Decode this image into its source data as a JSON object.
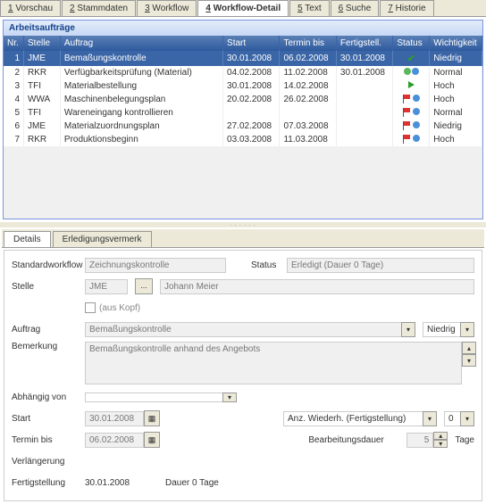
{
  "mainTabs": [
    "1 Vorschau",
    "2 Stammdaten",
    "3 Workflow",
    "4 Workflow-Detail",
    "5 Text",
    "6 Suche",
    "7 Historie"
  ],
  "mainTabActive": 3,
  "sectionTitle": "Arbeitsaufträge",
  "columns": {
    "nr": "Nr.",
    "stelle": "Stelle",
    "auftrag": "Auftrag",
    "start": "Start",
    "termin": "Termin bis",
    "fertig": "Fertigstell.",
    "status": "Status",
    "wicht": "Wichtigkeit"
  },
  "rows": [
    {
      "nr": "1",
      "stelle": "JME",
      "auftrag": "Bemaßungskontrolle",
      "start": "30.01.2008",
      "termin": "06.02.2008",
      "fertig": "30.01.2008",
      "status": "check",
      "wicht": "Niedrig",
      "sel": true
    },
    {
      "nr": "2",
      "stelle": "RKR",
      "auftrag": "Verfügbarkeitsprüfung (Material)",
      "start": "04.02.2008",
      "termin": "11.02.2008",
      "fertig": "30.01.2008",
      "status": "run-green",
      "wicht": "Normal"
    },
    {
      "nr": "3",
      "stelle": "TFI",
      "auftrag": "Materialbestellung",
      "start": "30.01.2008",
      "termin": "14.02.2008",
      "fertig": "",
      "status": "play",
      "wicht": "Hoch"
    },
    {
      "nr": "4",
      "stelle": "WWA",
      "auftrag": "Maschinenbelegungsplan",
      "start": "20.02.2008",
      "termin": "26.02.2008",
      "fertig": "",
      "status": "flag-red",
      "wicht": "Hoch"
    },
    {
      "nr": "5",
      "stelle": "TFI",
      "auftrag": "Wareneingang kontrollieren",
      "start": "",
      "termin": "",
      "fertig": "",
      "status": "flag-red",
      "wicht": "Normal"
    },
    {
      "nr": "6",
      "stelle": "JME",
      "auftrag": "Materialzuordnungsplan",
      "start": "27.02.2008",
      "termin": "07.03.2008",
      "fertig": "",
      "status": "flag-red",
      "wicht": "Niedrig"
    },
    {
      "nr": "7",
      "stelle": "RKR",
      "auftrag": "Produktionsbeginn",
      "start": "03.03.2008",
      "termin": "11.03.2008",
      "fertig": "",
      "status": "flag-red",
      "wicht": "Hoch"
    }
  ],
  "subTabs": [
    "Details",
    "Erledigungsvermerk"
  ],
  "subTabActive": 0,
  "form": {
    "lbl_stdwf": "Standardworkflow",
    "val_stdwf": "Zeichnungskontrolle",
    "lbl_status": "Status",
    "val_status": "Erledigt (Dauer 0 Tage)",
    "lbl_stelle": "Stelle",
    "val_stelle": "JME",
    "val_stelle_name": "Johann Meier",
    "dots": "...",
    "lbl_ausKopf": "(aus Kopf)",
    "lbl_auftrag": "Auftrag",
    "val_auftrag": "Bemaßungskontrolle",
    "val_prio": "Niedrig",
    "lbl_bemerkung": "Bemerkung",
    "val_bemerkung": "Bemaßungskontrolle anhand des Angebots",
    "lbl_abh": "Abhängig von",
    "lbl_start": "Start",
    "val_start": "30.01.2008",
    "lbl_anzw": "Anz. Wiederh. (Fertigstellung)",
    "val_anzw": "0",
    "lbl_termin": "Termin bis",
    "val_termin": "06.02.2008",
    "lbl_bearb": "Bearbeitungsdauer",
    "val_bearb": "5",
    "lbl_tage": "Tage",
    "lbl_verl": "Verlängerung",
    "lbl_fertig": "Fertigstellung",
    "val_fertig": "30.01.2008",
    "val_dauer": "Dauer 0 Tage"
  }
}
